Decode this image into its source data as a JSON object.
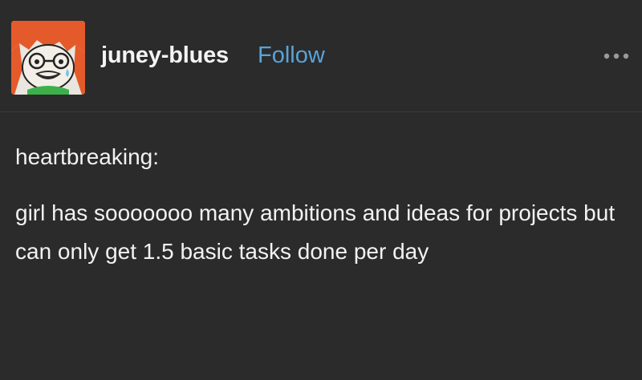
{
  "post": {
    "username": "juney-blues",
    "follow_label": "Follow",
    "more_icon": "more-horizontal-icon",
    "avatar_icon": "avatar",
    "heading_text": "heartbreaking:",
    "body_text": "girl has sooooooo many ambitions and ideas for projects but can only get 1.5 basic tasks done per day"
  },
  "colors": {
    "background": "#2b2b2b",
    "text": "#f2f2f2",
    "link": "#59a3d9"
  }
}
